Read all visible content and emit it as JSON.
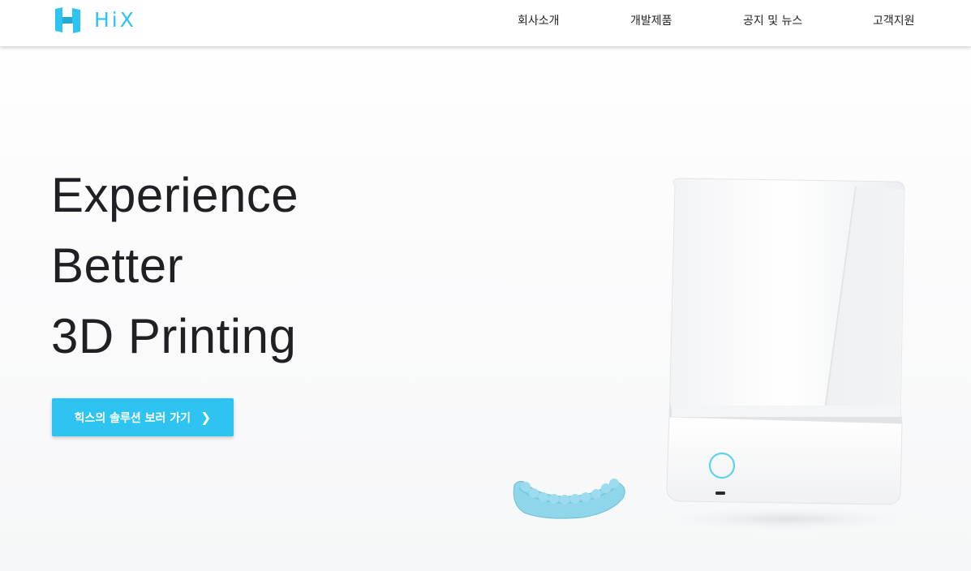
{
  "brand": {
    "name": "HiX",
    "accent_color": "#2ec4f2"
  },
  "nav": {
    "items": [
      {
        "label": "회사소개"
      },
      {
        "label": "개발제품"
      },
      {
        "label": "공지 및 뉴스"
      },
      {
        "label": "고객지원"
      }
    ]
  },
  "hero": {
    "lines": [
      "Experience",
      "Better",
      "3D Printing"
    ],
    "cta_label": "힉스의 솔루션 보러 가기",
    "cta_icon": "chevron-right-icon",
    "cta_arrow": "❯"
  },
  "illustration": {
    "printer_icon": "3d-printer-icon",
    "model_icon": "dental-model-icon",
    "printer_ring_color": "#5fd3ee",
    "model_color": "#8fd6ea"
  }
}
